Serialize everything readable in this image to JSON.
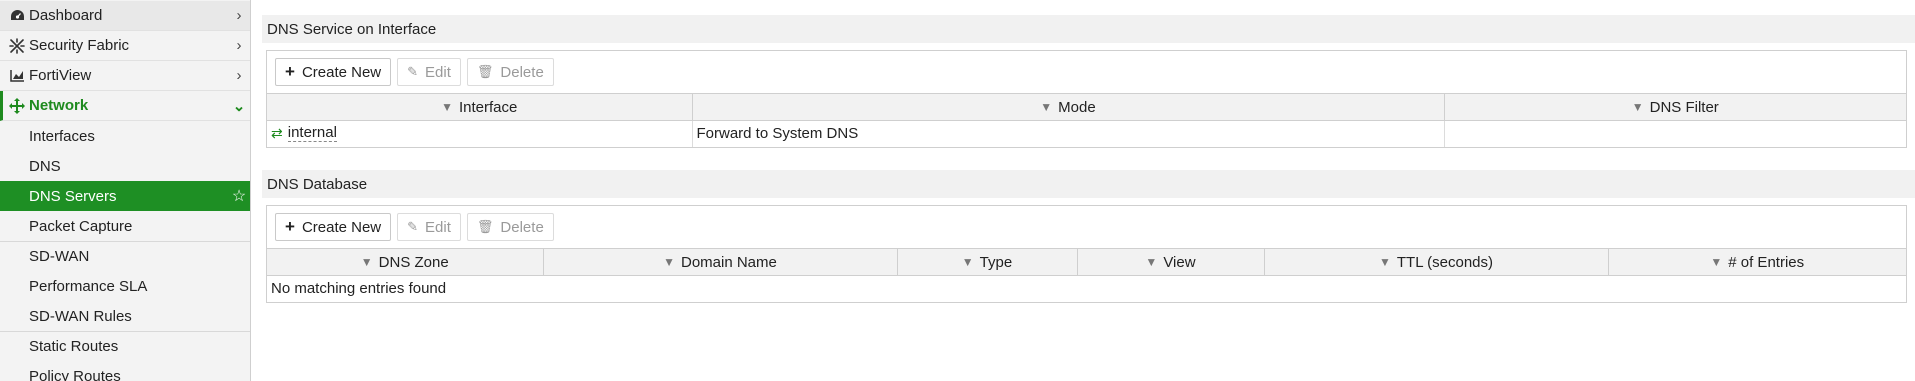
{
  "sidebar": {
    "top_items": [
      {
        "label": "Dashboard"
      },
      {
        "label": "Security Fabric"
      },
      {
        "label": "FortiView"
      },
      {
        "label": "Network"
      }
    ],
    "sub_items": [
      {
        "label": "Interfaces"
      },
      {
        "label": "DNS"
      },
      {
        "label": "DNS Servers"
      },
      {
        "label": "Packet Capture"
      },
      {
        "label": "SD-WAN"
      },
      {
        "label": "Performance SLA"
      },
      {
        "label": "SD-WAN Rules"
      },
      {
        "label": "Static Routes"
      },
      {
        "label": "Policy Routes"
      }
    ],
    "accent_color": "#1e8f24"
  },
  "dns_service": {
    "title": "DNS Service on Interface",
    "toolbar": {
      "create": "Create New",
      "edit": "Edit",
      "delete": "Delete"
    },
    "columns": [
      "Interface",
      "Mode",
      "DNS Filter"
    ],
    "rows": [
      {
        "interface": "internal",
        "mode": "Forward to System DNS",
        "dns_filter": ""
      }
    ]
  },
  "dns_database": {
    "title": "DNS Database",
    "toolbar": {
      "create": "Create New",
      "edit": "Edit",
      "delete": "Delete"
    },
    "columns": [
      "DNS Zone",
      "Domain Name",
      "Type",
      "View",
      "TTL (seconds)",
      "# of Entries"
    ],
    "empty_text": "No matching entries found"
  }
}
